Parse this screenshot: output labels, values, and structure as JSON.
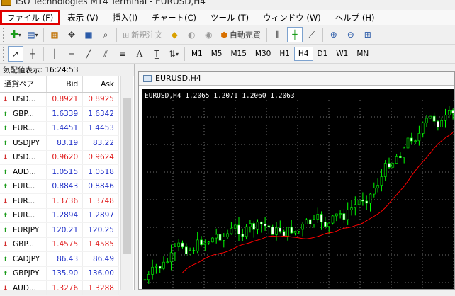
{
  "window": {
    "title": "ISO Technologies MT4 Terminal - EURUSD,H4"
  },
  "menu": [
    "ファイル (F)",
    "表示 (V)",
    "挿入(I)",
    "チャート(C)",
    "ツール (T)",
    "ウィンドウ (W)",
    "ヘルプ (H)"
  ],
  "toolbar": {
    "new_order": "新規注文",
    "auto_trade": "自動売買"
  },
  "timeframes": [
    "M1",
    "M5",
    "M15",
    "M30",
    "H1",
    "H4",
    "D1",
    "W1",
    "MN"
  ],
  "active_timeframe": "H4",
  "market_watch": {
    "header": "気配値表示: 16:24:53",
    "col_symbol": "通貨ペア",
    "col_bid": "Bid",
    "col_ask": "Ask",
    "rows": [
      {
        "symbol": "USD...",
        "bid": "0.8921",
        "ask": "0.8925",
        "dir": "down"
      },
      {
        "symbol": "GBP...",
        "bid": "1.6339",
        "ask": "1.6342",
        "dir": "up"
      },
      {
        "symbol": "EUR...",
        "bid": "1.4451",
        "ask": "1.4453",
        "dir": "up"
      },
      {
        "symbol": "USDJPY",
        "bid": "83.19",
        "ask": "83.22",
        "dir": "up"
      },
      {
        "symbol": "USD...",
        "bid": "0.9620",
        "ask": "0.9624",
        "dir": "down"
      },
      {
        "symbol": "AUD...",
        "bid": "1.0515",
        "ask": "1.0518",
        "dir": "up"
      },
      {
        "symbol": "EUR...",
        "bid": "0.8843",
        "ask": "0.8846",
        "dir": "up"
      },
      {
        "symbol": "EUR...",
        "bid": "1.3736",
        "ask": "1.3748",
        "dir": "down"
      },
      {
        "symbol": "EUR...",
        "bid": "1.2894",
        "ask": "1.2897",
        "dir": "up"
      },
      {
        "symbol": "EURJPY",
        "bid": "120.21",
        "ask": "120.25",
        "dir": "up"
      },
      {
        "symbol": "GBP...",
        "bid": "1.4575",
        "ask": "1.4585",
        "dir": "down"
      },
      {
        "symbol": "CADJPY",
        "bid": "86.43",
        "ask": "86.49",
        "dir": "up"
      },
      {
        "symbol": "GBPJPY",
        "bid": "135.90",
        "ask": "136.00",
        "dir": "up"
      },
      {
        "symbol": "AUD...",
        "bid": "1.3276",
        "ask": "1.3288",
        "dir": "down"
      }
    ]
  },
  "chart": {
    "window_title": "EURUSD,H4",
    "info": "EURUSD,H4  1.2065 1.2071 1.2060 1.2063",
    "colors": {
      "background": "#000000",
      "bull": "#00ff00",
      "bear": "#ffffff",
      "ma": "#ff0000",
      "grid": "#6e6e6e"
    }
  }
}
